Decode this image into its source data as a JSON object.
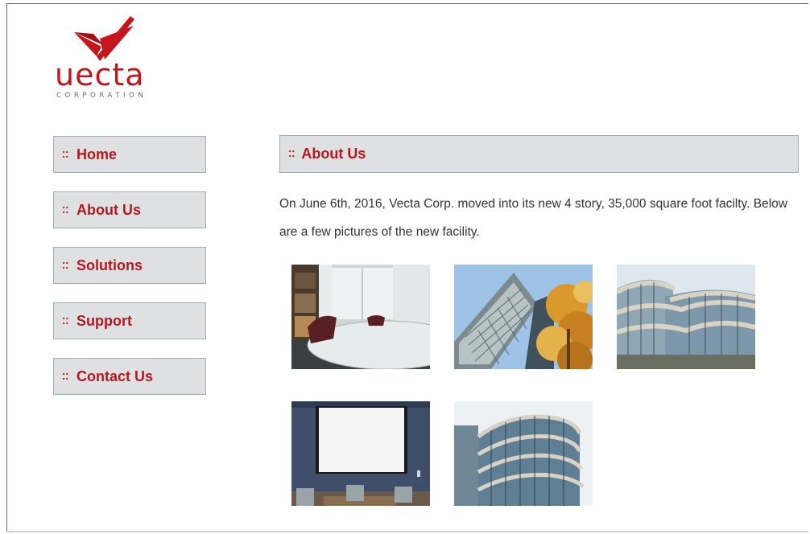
{
  "brand": {
    "wordmark": "uecta",
    "subtitle": "CORPORATION",
    "color": "#c4161c"
  },
  "nav": {
    "bullet_icon": "grip-bullet-icon",
    "items": [
      {
        "label": "Home"
      },
      {
        "label": "About Us"
      },
      {
        "label": "Solutions"
      },
      {
        "label": "Support"
      },
      {
        "label": "Contact Us"
      }
    ]
  },
  "content": {
    "heading": "About Us",
    "intro": "On June 6th, 2016, Vecta Corp. moved into its new 4 story, 35,000 square foot facilty. Below are a few pictures of the new facility."
  },
  "colors": {
    "accent": "#b3191f",
    "panel_bg": "#dfe0e2",
    "panel_border": "#a9abae",
    "text": "#333333"
  }
}
